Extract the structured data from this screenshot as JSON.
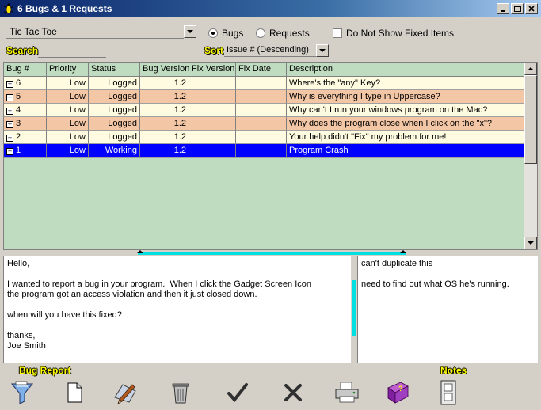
{
  "window": {
    "title": "6 Bugs & 1 Requests"
  },
  "project_select": {
    "value": "Tic Tac Toe"
  },
  "view_filter": {
    "bugs_label": "Bugs",
    "requests_label": "Requests",
    "selected": "Bugs",
    "hide_fixed_label": "Do Not Show Fixed Items",
    "hide_fixed_checked": false
  },
  "search": {
    "label": "Search",
    "value": ""
  },
  "sort": {
    "label": "Sort",
    "value": "Issue # (Descending)"
  },
  "grid": {
    "columns": [
      "Bug #",
      "Priority",
      "Status",
      "Bug Version",
      "Fix Version",
      "Fix Date",
      "Description"
    ],
    "rows": [
      {
        "id": "6",
        "priority": "Low",
        "status": "Logged",
        "bug_version": "1.2",
        "fix_version": "",
        "fix_date": "",
        "description": "Where's the \"any\" Key?",
        "style": "light"
      },
      {
        "id": "5",
        "priority": "Low",
        "status": "Logged",
        "bug_version": "1.2",
        "fix_version": "",
        "fix_date": "",
        "description": "Why is everything I type in Uppercase?",
        "style": "peach"
      },
      {
        "id": "4",
        "priority": "Low",
        "status": "Logged",
        "bug_version": "1.2",
        "fix_version": "",
        "fix_date": "",
        "description": "Why can't I run your windows program on the Mac?",
        "style": "light"
      },
      {
        "id": "3",
        "priority": "Low",
        "status": "Logged",
        "bug_version": "1.2",
        "fix_version": "",
        "fix_date": "",
        "description": "Why does the program close when I click on the \"x\"?",
        "style": "peach"
      },
      {
        "id": "2",
        "priority": "Low",
        "status": "Logged",
        "bug_version": "1.2",
        "fix_version": "",
        "fix_date": "",
        "description": "Your help didn't \"Fix\" my problem for me!",
        "style": "light"
      },
      {
        "id": "1",
        "priority": "Low",
        "status": "Working",
        "bug_version": "1.2",
        "fix_version": "",
        "fix_date": "",
        "description": "Program Crash",
        "style": "sel"
      }
    ]
  },
  "bug_report_text": [
    "Hello,",
    "",
    "I wanted to report a bug in your program.  When I click the Gadget Screen Icon",
    "the program got an access violation and then it just closed down.",
    "",
    "when will you have this fixed?",
    "",
    "thanks,",
    "Joe Smith"
  ],
  "notes_text": [
    "can't duplicate this",
    "",
    "need to find out what OS he's running."
  ],
  "bottom": {
    "bug_report_label": "Bug Report",
    "notes_label": "Notes"
  },
  "colors": {
    "grid_bg": "#c0dcc0",
    "row_light": "#fffbe0",
    "row_peach": "#f3c7a6",
    "row_selected": "#0000ff",
    "splitter": "#00e0e0"
  },
  "icons": [
    "filter-funnel-icon",
    "new-document-icon",
    "edit-pen-icon",
    "trash-can-icon",
    "check-mark-icon",
    "x-mark-icon",
    "printer-icon",
    "help-book-icon",
    "notes-panel-icon"
  ]
}
